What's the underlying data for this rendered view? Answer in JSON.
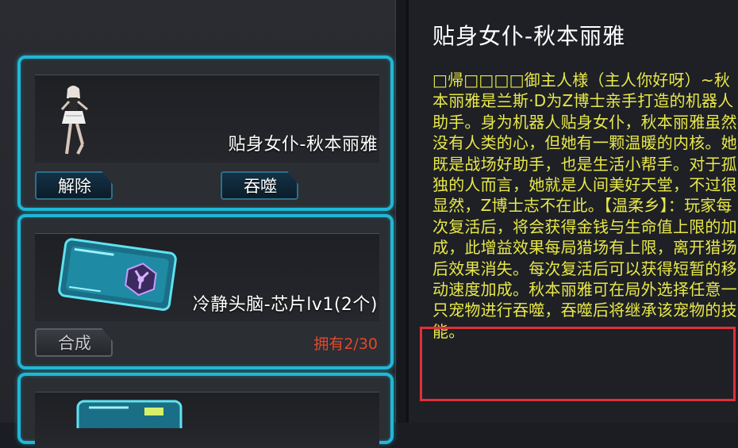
{
  "pet_list": {
    "items": [
      {
        "name": "贴身女仆-秋本丽雅",
        "buttons": {
          "release": "解除",
          "devour": "吞噬"
        }
      },
      {
        "name": "冷静头脑-芯片lv1(2个)",
        "buttons": {
          "combine": "合成"
        },
        "owned": "拥有2/30"
      },
      {
        "name": ""
      }
    ]
  },
  "detail": {
    "title": "贴身女仆-秋本丽雅",
    "description": "□帰□□□□御主人様（主人你好呀）~秋本丽雅是兰斯·D为Z博士亲手打造的机器人助手。身为机器人贴身女仆，秋本丽雅虽然没有人类的心，但她有一颗温暖的内核。她既是战场好助手，也是生活小帮手。对于孤独的人而言，她就是人间美好天堂，不过很显然，Z博士志不在此。【温柔乡】：玩家每次复活后，将会获得金钱与生命值上限的加成，此增益效果每局猎场有上限，离开猎场后效果消失。每次复活后可以获得短暂的移动速度加成。秋本丽雅可在局外选择任意一只宠物进行吞噬，吞噬后将继承该宠物的技能。"
  },
  "colors": {
    "card_border": "#1fb8d6",
    "description_text": "#e8e84a",
    "owned_text": "#e2482c",
    "highlight_border": "#e0303a"
  }
}
